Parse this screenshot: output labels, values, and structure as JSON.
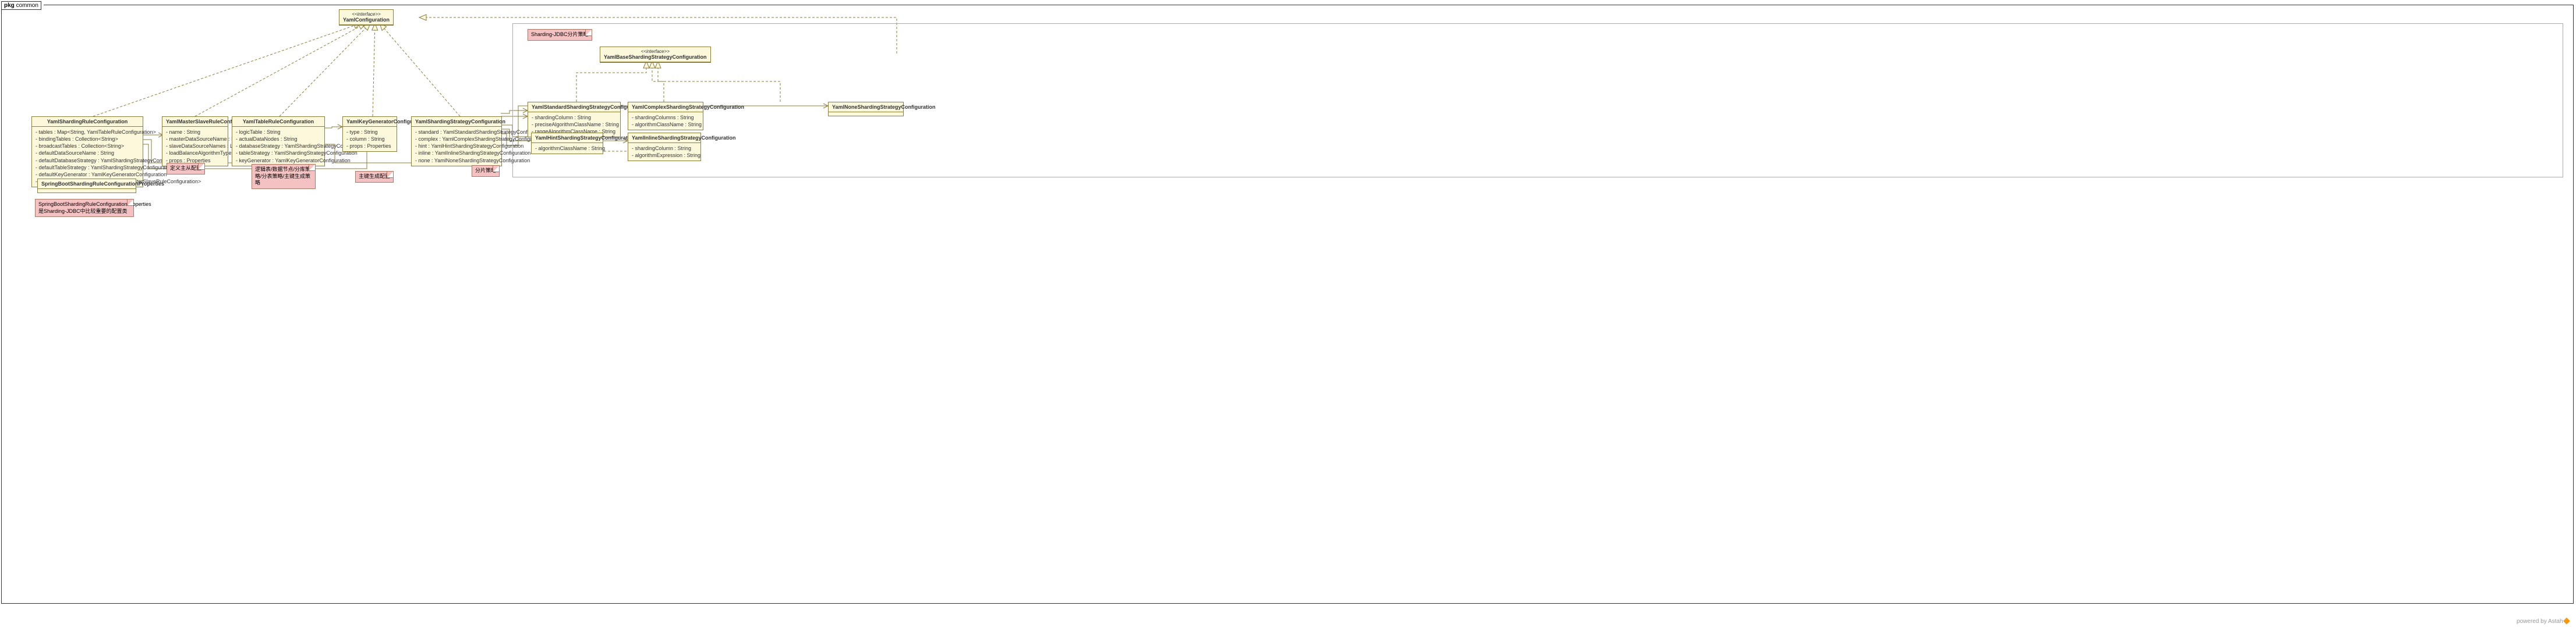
{
  "pkg": {
    "prefix": "pkg",
    "name": "common"
  },
  "footer": {
    "text": "powered by Astah",
    "orange": "🔶"
  },
  "innerBoxNote": "Sharding-JDBC分片策略",
  "classes": {
    "yamlConfig": {
      "stereo": "<<interface>>",
      "name": "YamlConfiguration"
    },
    "shardingRule": {
      "name": "YamlShardingRuleConfiguration",
      "fields": [
        "- tables : Map<String, YamlTableRuleConfiguration>",
        "- bindingTables : Collection<String>",
        "- broadcastTables : Collection<String>",
        "- defaultDataSourceName : String",
        "- defaultDatabaseStrategy : YamlShardingStrategyConfiguration",
        "- defaultTableStrategy : YamlShardingStrategyConfiguration",
        "- defaultKeyGenerator : YamlKeyGeneratorConfiguration",
        "- masterSlaveRules : Map<String, YamlMasterSlaveRuleConfiguration>"
      ]
    },
    "masterSlave": {
      "name": "YamlMasterSlaveRuleConfiguration",
      "fields": [
        "- name : String",
        "- masterDataSourceName : String",
        "- slaveDataSourceNames : List<String>",
        "- loadBalanceAlgorithmType : String",
        "- props : Properties"
      ]
    },
    "tableRule": {
      "name": "YamlTableRuleConfiguration",
      "fields": [
        "- logicTable : String",
        "- actualDataNodes : String",
        "- databaseStrategy : YamlShardingStrategyConfiguration",
        "- tableStrategy : YamlShardingStrategyConfiguration",
        "- keyGenerator : YamlKeyGeneratorConfiguration"
      ]
    },
    "keyGen": {
      "name": "YamlKeyGeneratorConfiguration",
      "fields": [
        "- type : String",
        "- column : String",
        "- props : Properties"
      ]
    },
    "shardingStrategy": {
      "name": "YamlShardingStrategyConfiguration",
      "fields": [
        "- standard : YamlStandardShardingStrategyConfiguration",
        "- complex : YamlComplexShardingStrategyConfiguration",
        "- hint : YamlHintShardingStrategyConfiguration",
        "- inline : YamlInlineShardingStrategyConfiguration",
        "- none : YamlNoneShardingStrategyConfiguration"
      ]
    },
    "springBoot": {
      "name": "SpringBootShardingRuleConfigurationProperties"
    },
    "baseStrategy": {
      "stereo": "<<interface>>",
      "name": "YamlBaseShardingStrategyConfiguration"
    },
    "standard": {
      "name": "YamlStandardShardingStrategyConfiguration",
      "fields": [
        "- shardingColumn : String",
        "- preciseAlgorithmClassName : String",
        "- rangeAlgorithmClassName : String"
      ]
    },
    "complex": {
      "name": "YamlComplexShardingStrategyConfiguration",
      "fields": [
        "- shardingColumns : String",
        "- algorithmClassName : String"
      ]
    },
    "none": {
      "name": "YamlNoneShardingStrategyConfiguration"
    },
    "hint": {
      "name": "YamlHintShardingStrategyConfiguration",
      "fields": [
        "- algorithmClassName : String"
      ]
    },
    "inline": {
      "name": "YamlInlineShardingStrategyConfiguration",
      "fields": [
        "- shardingColumn : String",
        "- algorithmExpression : String"
      ]
    }
  },
  "notes": {
    "masterSlave": "定义主从配置",
    "tableRule": "逻辑表/数据节点/分库策略/分表策略/主键生成策略",
    "keyGen": "主键生成配置",
    "shardingStrategy": "分片策略",
    "springBoot": "SpringBootShardingRuleConfigurationProperties是Sharding-JDBC中比较重要的配置类"
  }
}
